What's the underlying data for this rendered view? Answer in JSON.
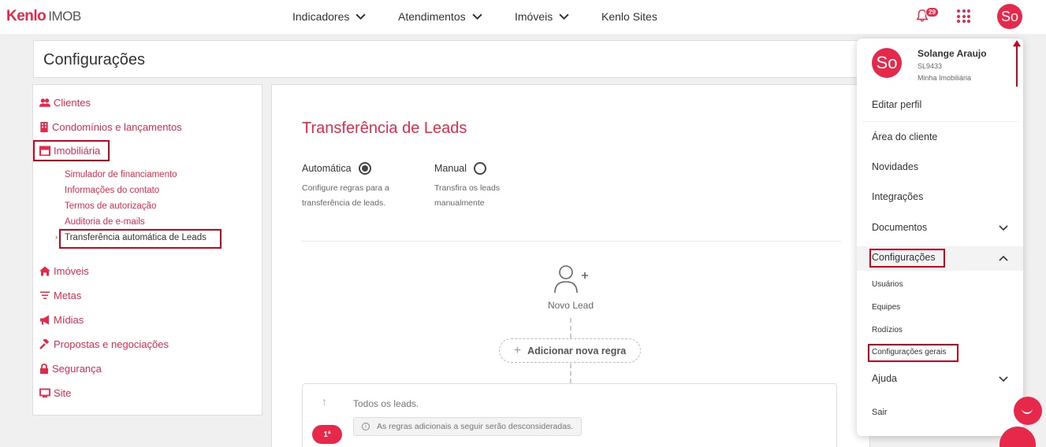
{
  "brand": {
    "logo": "Kenlo",
    "suffix": "IMOB",
    "accent": "#e8284b"
  },
  "topnav": {
    "items": [
      "Indicadores",
      "Atendimentos",
      "Imóveis",
      "Kenlo Sites"
    ],
    "notifications_count": "29",
    "avatar_initials": "So"
  },
  "page": {
    "title": "Configurações"
  },
  "sidebar": {
    "items": [
      "Clientes",
      "Condomínios e lançamentos",
      "Imobiliária",
      "Imóveis",
      "Metas",
      "Mídias",
      "Propostas e negociações",
      "Segurança",
      "Site"
    ],
    "subitems": [
      "Simulador de financiamento",
      "Informações do contato",
      "Termos de autorização",
      "Auditoria de e-mails",
      "Transferência automática de Leads"
    ],
    "active_caret": "›"
  },
  "main": {
    "title": "Transferência de Leads",
    "option_auto": "Automática",
    "option_auto_desc": "Configure regras para a transferência de leads.",
    "option_manual": "Manual",
    "option_manual_desc": "Transfira os leads manualmente",
    "novo_lead": "Novo Lead",
    "add_rule": "Adicionar nova regra",
    "todos_leads": "Todos os leads.",
    "rank": "1ª",
    "rules_note": "As regras adicionais a seguir serão desconsideradas."
  },
  "dropdown": {
    "avatar_initials": "So",
    "name": "Solange Araujo",
    "code": "SL9433",
    "company": "Minha Imobiliária",
    "items": [
      "Editar perfil",
      "Área do cliente",
      "Novidades",
      "Integrações",
      "Documentos",
      "Configurações"
    ],
    "config_subitems": [
      "Usuários",
      "Equipes",
      "Rodízios",
      "Configurações gerais"
    ],
    "ajuda": "Ajuda",
    "sair": "Sair"
  }
}
